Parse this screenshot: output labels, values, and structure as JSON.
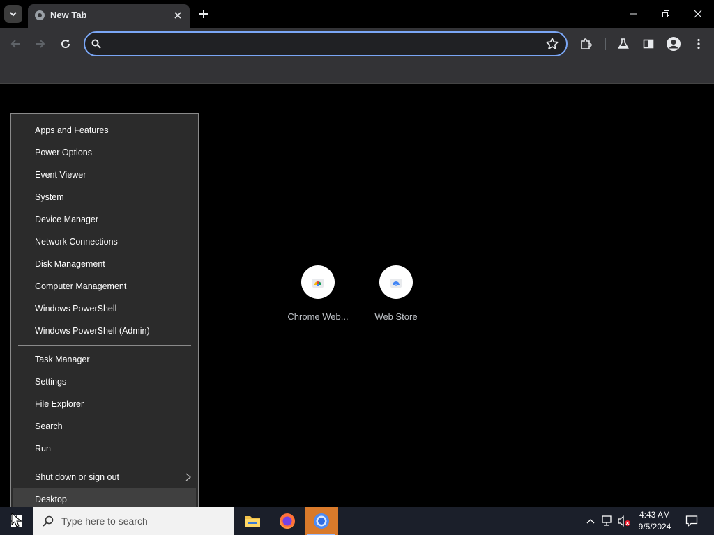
{
  "browser": {
    "tab": {
      "title": "New Tab"
    },
    "omnibox": {
      "value": "",
      "placeholder": ""
    }
  },
  "ntp": {
    "shortcuts": [
      {
        "label": "Chrome Web..."
      },
      {
        "label": "Web Store"
      }
    ]
  },
  "winx_menu": {
    "group1": [
      "Apps and Features",
      "Power Options",
      "Event Viewer",
      "System",
      "Device Manager",
      "Network Connections",
      "Disk Management",
      "Computer Management",
      "Windows PowerShell",
      "Windows PowerShell (Admin)"
    ],
    "group2": [
      "Task Manager",
      "Settings",
      "File Explorer",
      "Search",
      "Run"
    ],
    "shutdown": "Shut down or sign out",
    "desktop": "Desktop"
  },
  "taskbar": {
    "search_placeholder": "Type here to search",
    "time": "4:43 AM",
    "date": "9/5/2024"
  },
  "colors": {
    "omnibox_focus": "#7aa6f5",
    "active_app": "#d97a2b",
    "menu_bg": "#2b2b2b"
  }
}
